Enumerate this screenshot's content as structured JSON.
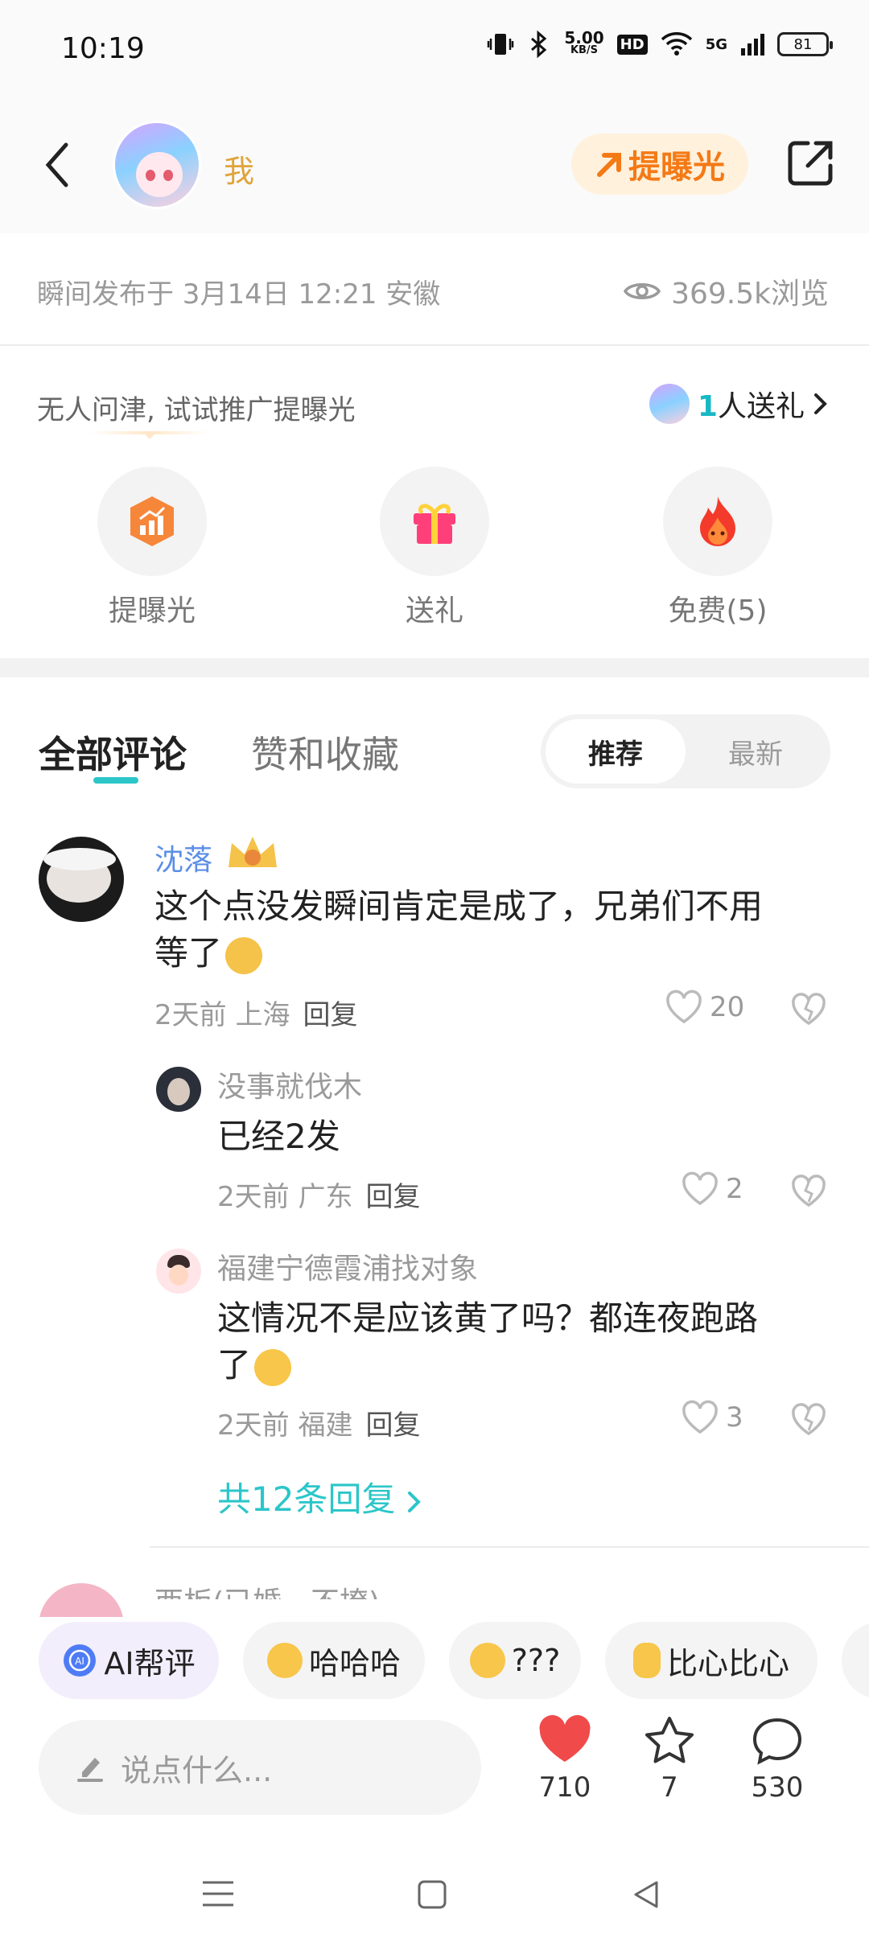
{
  "status": {
    "time": "10:19",
    "net_speed": "5.00",
    "net_unit": "KB/S",
    "hd": "HD",
    "signal": "5G",
    "battery": "81"
  },
  "header": {
    "username": "我",
    "boost_label": "提曝光"
  },
  "meta": {
    "published": "瞬间发布于 3月14日 12:21 安徽",
    "views": "369.5k浏览"
  },
  "promo": {
    "hint": "无人问津, 试试推广提曝光",
    "gift_count": "1",
    "gift_suffix": "人送礼",
    "actions": [
      {
        "label": "提曝光"
      },
      {
        "label": "送礼"
      },
      {
        "label": "免费(5)"
      }
    ]
  },
  "tabs": {
    "all_comments": "全部评论",
    "likes_favs": "赞和收藏",
    "sort_recommended": "推荐",
    "sort_latest": "最新"
  },
  "comments": [
    {
      "user": "沈落",
      "text_line1": "这个点没发瞬间肯定是成了，兄弟们不用",
      "text_line2": "等了",
      "time_loc": "2天前 上海",
      "reply": "回复",
      "likes": "20"
    },
    {
      "user": "没事就伐木",
      "text_line1": "已经2发",
      "time_loc": "2天前 广东",
      "reply": "回复",
      "likes": "2"
    },
    {
      "user": "福建宁德霞浦找对象",
      "text_line1": "这情况不是应该黄了吗？都连夜跑路",
      "text_line2": "了",
      "time_loc": "2天前 福建",
      "reply": "回复",
      "likes": "3"
    }
  ],
  "more_replies": "共12条回复",
  "next_user_partial": "西板(已婚，不撩)",
  "quick_reactions": [
    {
      "label": "AI帮评"
    },
    {
      "label": "哈哈哈"
    },
    {
      "label": "???"
    },
    {
      "label": "比心比心"
    }
  ],
  "input": {
    "placeholder": "说点什么..."
  },
  "stats": {
    "likes": "710",
    "favorites": "7",
    "comments": "530"
  },
  "colors": {
    "accent_teal": "#2cc6c9",
    "boost_orange": "#f47a16",
    "like_red": "#f04a4a",
    "name_blue": "#5b8ee6"
  }
}
